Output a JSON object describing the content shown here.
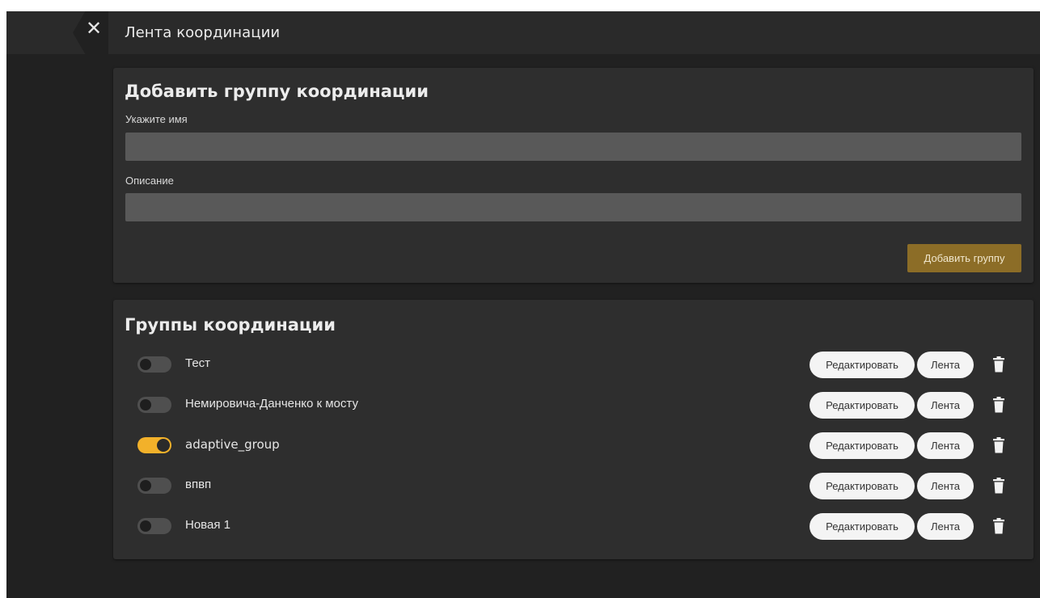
{
  "header": {
    "close_icon": "close-icon",
    "close_glyph": "✕",
    "title": "Лента координации"
  },
  "add_group": {
    "heading": "Добавить группу координации",
    "name_label": "Укажите имя",
    "name_value": "",
    "description_label": "Описание",
    "description_value": "",
    "submit_label": "Добавить группу"
  },
  "groups": {
    "heading": "Группы координации",
    "edit_label": "Редактировать",
    "feed_label": "Лента",
    "delete_icon": "trash-icon",
    "items": [
      {
        "name": "Тест",
        "enabled": false
      },
      {
        "name": "Немировича-Данченко к мосту",
        "enabled": false
      },
      {
        "name": "adaptive_group",
        "enabled": true
      },
      {
        "name": "впвп",
        "enabled": false
      },
      {
        "name": "Новая 1",
        "enabled": false
      }
    ]
  },
  "colors": {
    "accent": "#f2b12a",
    "button_primary": "#8c6d27",
    "background": "#212121",
    "card": "#2e2e2e"
  }
}
